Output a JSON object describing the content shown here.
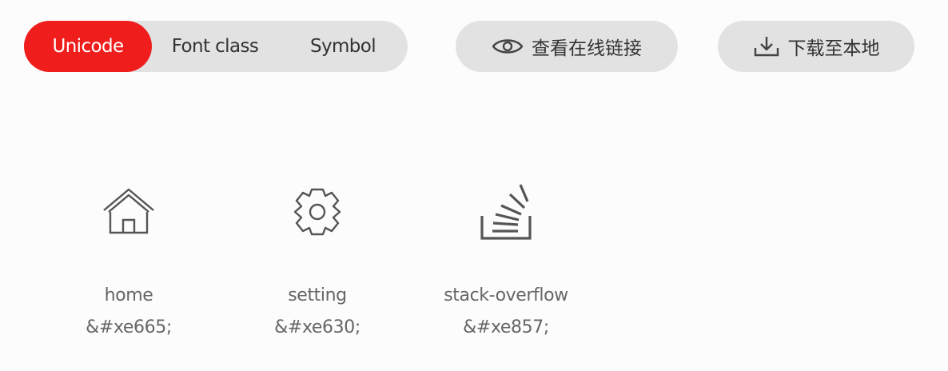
{
  "tabs": {
    "unicode": "Unicode",
    "font_class": "Font class",
    "symbol": "Symbol",
    "active": "Unicode",
    "active_color": "#f01d1d"
  },
  "actions": {
    "view_online_label": "查看在线链接",
    "view_online_icon": "eye-icon",
    "download_label": "下载至本地",
    "download_icon": "download-icon"
  },
  "icons": [
    {
      "name": "home",
      "code": "&#xe665;",
      "icon": "home-icon"
    },
    {
      "name": "setting",
      "code": "&#xe630;",
      "icon": "gear-icon"
    },
    {
      "name": "stack-overflow",
      "code": "&#xe857;",
      "icon": "stack-overflow-icon"
    }
  ]
}
